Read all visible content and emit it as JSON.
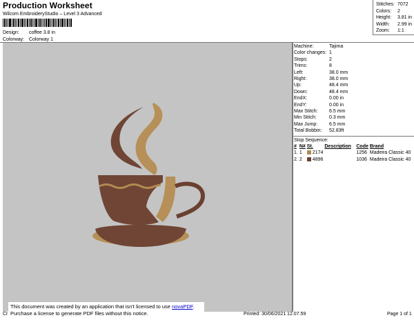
{
  "header": {
    "title": "Production Worksheet",
    "subtitle": "Wilcom EmbroideryStudio – Level 3 Advanced",
    "design_label": "Design:",
    "design_value": "coffee 3.8 in",
    "colorway_label": "Colorway:",
    "colorway_value": "Colorway 1"
  },
  "stats": [
    {
      "label": "Stitches:",
      "value": "7072"
    },
    {
      "label": "Colors:",
      "value": "2"
    },
    {
      "label": "Height:",
      "value": "3.81 in"
    },
    {
      "label": "Width:",
      "value": "2.99 in"
    },
    {
      "label": "Zoom:",
      "value": "1:1"
    }
  ],
  "machine": [
    {
      "label": "Machine:",
      "value": "Tajima"
    },
    {
      "label": "Color changes:",
      "value": "1"
    },
    {
      "label": "Stops:",
      "value": "2"
    },
    {
      "label": "Trims:",
      "value": "8"
    },
    {
      "label": "Left:",
      "value": "38.0 mm"
    },
    {
      "label": "Right:",
      "value": "38.0 mm"
    },
    {
      "label": "Up:",
      "value": "48.4 mm"
    },
    {
      "label": "Down:",
      "value": "48.4 mm"
    },
    {
      "label": "EndX:",
      "value": "0.00 in"
    },
    {
      "label": "EndY:",
      "value": "0.00 in"
    },
    {
      "label": "Max Stitch:",
      "value": "6.5 mm"
    },
    {
      "label": "Min Stitch:",
      "value": "0.3 mm"
    },
    {
      "label": "Max Jump:",
      "value": "6.5 mm"
    },
    {
      "label": "Total Bobbin:",
      "value": "52.83ft"
    }
  ],
  "stop_sequence": {
    "title": "Stop Sequence:",
    "headers": [
      "#",
      "N#",
      "St.",
      "Description",
      "Code",
      "Brand"
    ],
    "rows": [
      {
        "num": "1.",
        "n": "1",
        "st": "2174",
        "desc": "",
        "code": "1256",
        "brand": "Madeira Classic 40",
        "color": "#b08a52"
      },
      {
        "num": "2.",
        "n": "2",
        "st": "4896",
        "desc": "",
        "code": "1036",
        "brand": "Madeira Classic 40",
        "color": "#6a4030"
      }
    ]
  },
  "colors": {
    "canvas_bg": "#c4c4c4",
    "thread_gold": "#b08a52",
    "thread_brown": "#6a4030"
  },
  "footer": {
    "left": "Cr",
    "printed": "Printed: 30/06/2021 12.07.59",
    "page": "Page 1 of 1"
  },
  "notice": {
    "line1_pre": "This document was created by an application that isn't licensed to use ",
    "link": "novaPDF",
    "line1_post": ".",
    "line2": "Purchase a license to generate PDF files without this notice."
  }
}
